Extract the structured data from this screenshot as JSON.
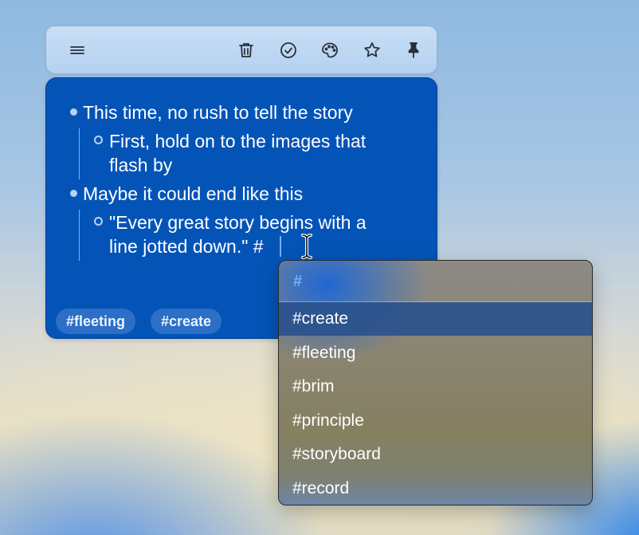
{
  "toolbar": {
    "icons": [
      "menu-icon",
      "trash-icon",
      "check-circle-icon",
      "palette-icon",
      "star-icon",
      "pin-icon"
    ]
  },
  "note": {
    "items": [
      {
        "level": 1,
        "lines": [
          "This time, no rush to tell the story"
        ]
      },
      {
        "level": 2,
        "lines": [
          "First, hold on to the images that",
          "flash by"
        ]
      },
      {
        "level": 1,
        "lines": [
          "Maybe it could end like this"
        ]
      },
      {
        "level": 2,
        "lines": [
          "\"Every great story begins with a",
          "line jotted down.\" #"
        ]
      }
    ],
    "tags": [
      "#fleeting",
      "#create"
    ]
  },
  "popup": {
    "query": "#",
    "options": [
      "#create",
      "#fleeting",
      "#brim",
      "#principle",
      "#storyboard",
      "#record"
    ],
    "selected": "#create"
  },
  "colors": {
    "note_bg": "#0454b8",
    "tag_bg": "#2b6fc6",
    "accent": "#6fb1ff",
    "selected_option": "#2c5088"
  }
}
